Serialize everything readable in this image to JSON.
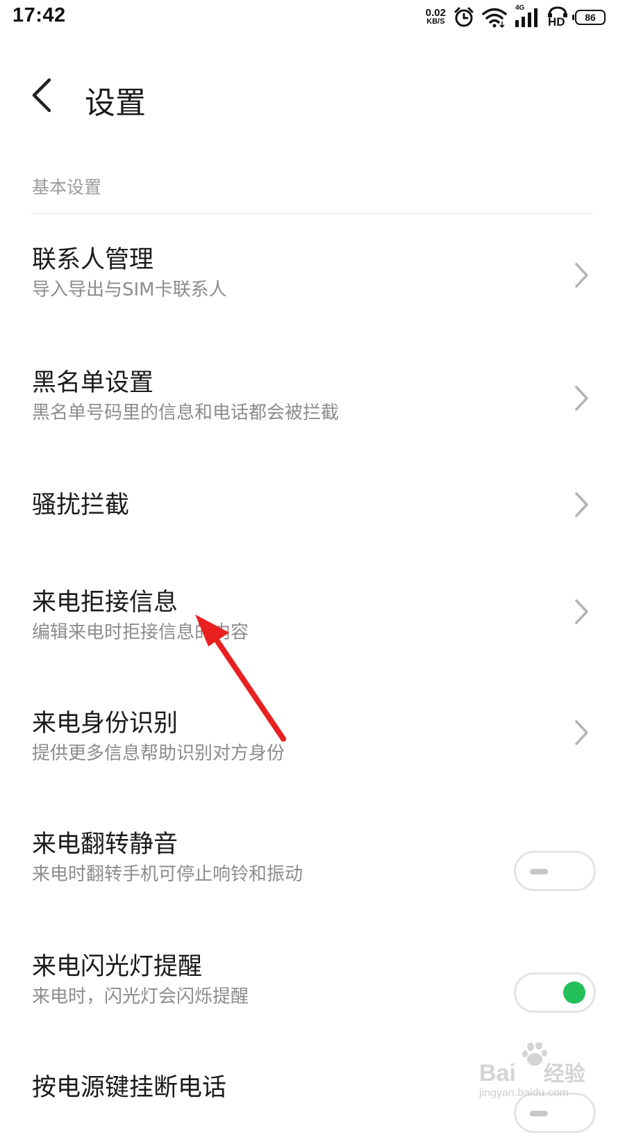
{
  "status_bar": {
    "time": "17:42",
    "net_speed_value": "0.02",
    "net_speed_unit": "KB/S",
    "network_type": "4G",
    "hd_label": "HD",
    "battery_level": "86",
    "icons": [
      "alarm-icon",
      "wifi-icon",
      "signal-icon",
      "hd-voice-icon",
      "battery-icon"
    ]
  },
  "header": {
    "title": "设置",
    "back_icon": "chevron-left-icon"
  },
  "section": {
    "title": "基本设置"
  },
  "settings": [
    {
      "title": "联系人管理",
      "subtitle": "导入导出与SIM卡联系人",
      "control": "chevron"
    },
    {
      "title": "黑名单设置",
      "subtitle": "黑名单号码里的信息和电话都会被拦截",
      "control": "chevron"
    },
    {
      "title": "骚扰拦截",
      "subtitle": "",
      "control": "chevron"
    },
    {
      "title": "来电拒接信息",
      "subtitle": "编辑来电时拒接信息的内容",
      "control": "chevron"
    },
    {
      "title": "来电身份识别",
      "subtitle": "提供更多信息帮助识别对方身份",
      "control": "chevron"
    },
    {
      "title": "来电翻转静音",
      "subtitle": "来电时翻转手机可停止响铃和振动",
      "control": "toggle",
      "on": false
    },
    {
      "title": "来电闪光灯提醒",
      "subtitle": "来电时，闪光灯会闪烁提醒",
      "control": "toggle",
      "on": true
    },
    {
      "title": "按电源键挂断电话",
      "subtitle": "",
      "control": "toggle",
      "on": false
    }
  ],
  "colors": {
    "toggle_on": "#23c05a",
    "annotation_arrow": "#e8201f",
    "secondary_text": "#8c8c8c",
    "section_text": "#9a9a9a"
  },
  "watermark": {
    "brand_left": "Bai",
    "brand_right": "经验",
    "url": "jingyan.baidu.com"
  }
}
